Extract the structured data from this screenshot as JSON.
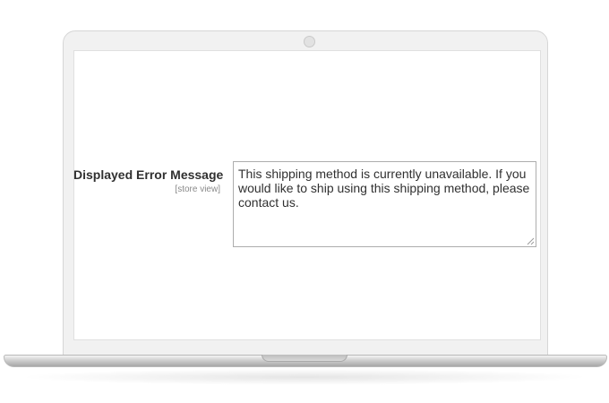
{
  "form": {
    "error_message_field": {
      "label": "Displayed Error Message",
      "scope": "[store view]",
      "value": "This shipping method is currently unavailable. If you would like to ship using this shipping method, please contact us."
    }
  },
  "icons": {
    "camera": "webcam-icon",
    "resize": "resize-handle-icon"
  },
  "colors": {
    "label_text": "#303030",
    "scope_text": "#8a8a8a",
    "textarea_border": "#adadad",
    "laptop_frame": "#f1f1f1"
  }
}
